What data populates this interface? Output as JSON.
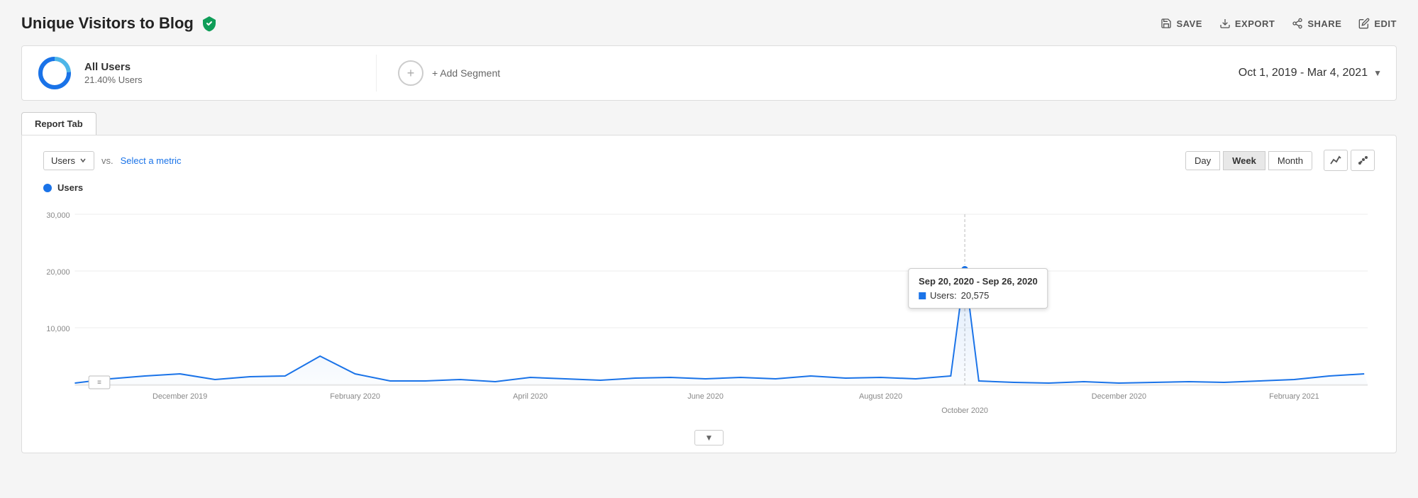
{
  "header": {
    "title": "Unique Visitors to Blog",
    "actions": {
      "save": "SAVE",
      "export": "EXPORT",
      "share": "SHARE",
      "edit": "EDIT"
    }
  },
  "segment": {
    "name": "All Users",
    "percentage": "21.40% Users",
    "add_label": "+ Add Segment"
  },
  "date_range": {
    "label": "Oct 1, 2019 - Mar 4, 2021"
  },
  "report_tab": {
    "label": "Report Tab"
  },
  "chart_controls": {
    "metric_label": "Users",
    "vs_label": "vs.",
    "select_metric": "Select a metric",
    "time_buttons": [
      "Day",
      "Week",
      "Month"
    ],
    "active_time": "Week"
  },
  "chart": {
    "legend_label": "Users",
    "y_axis": [
      "30,000",
      "20,000",
      "10,000"
    ],
    "x_axis": [
      "December 2019",
      "February 2020",
      "April 2020",
      "June 2020",
      "August 2020",
      "October 2020",
      "December 2020",
      "February 2021"
    ],
    "tooltip": {
      "date": "Sep 20, 2020 - Sep 26, 2020",
      "metric": "Users:",
      "value": "20,575"
    }
  },
  "scroll": {
    "label": "▼"
  }
}
